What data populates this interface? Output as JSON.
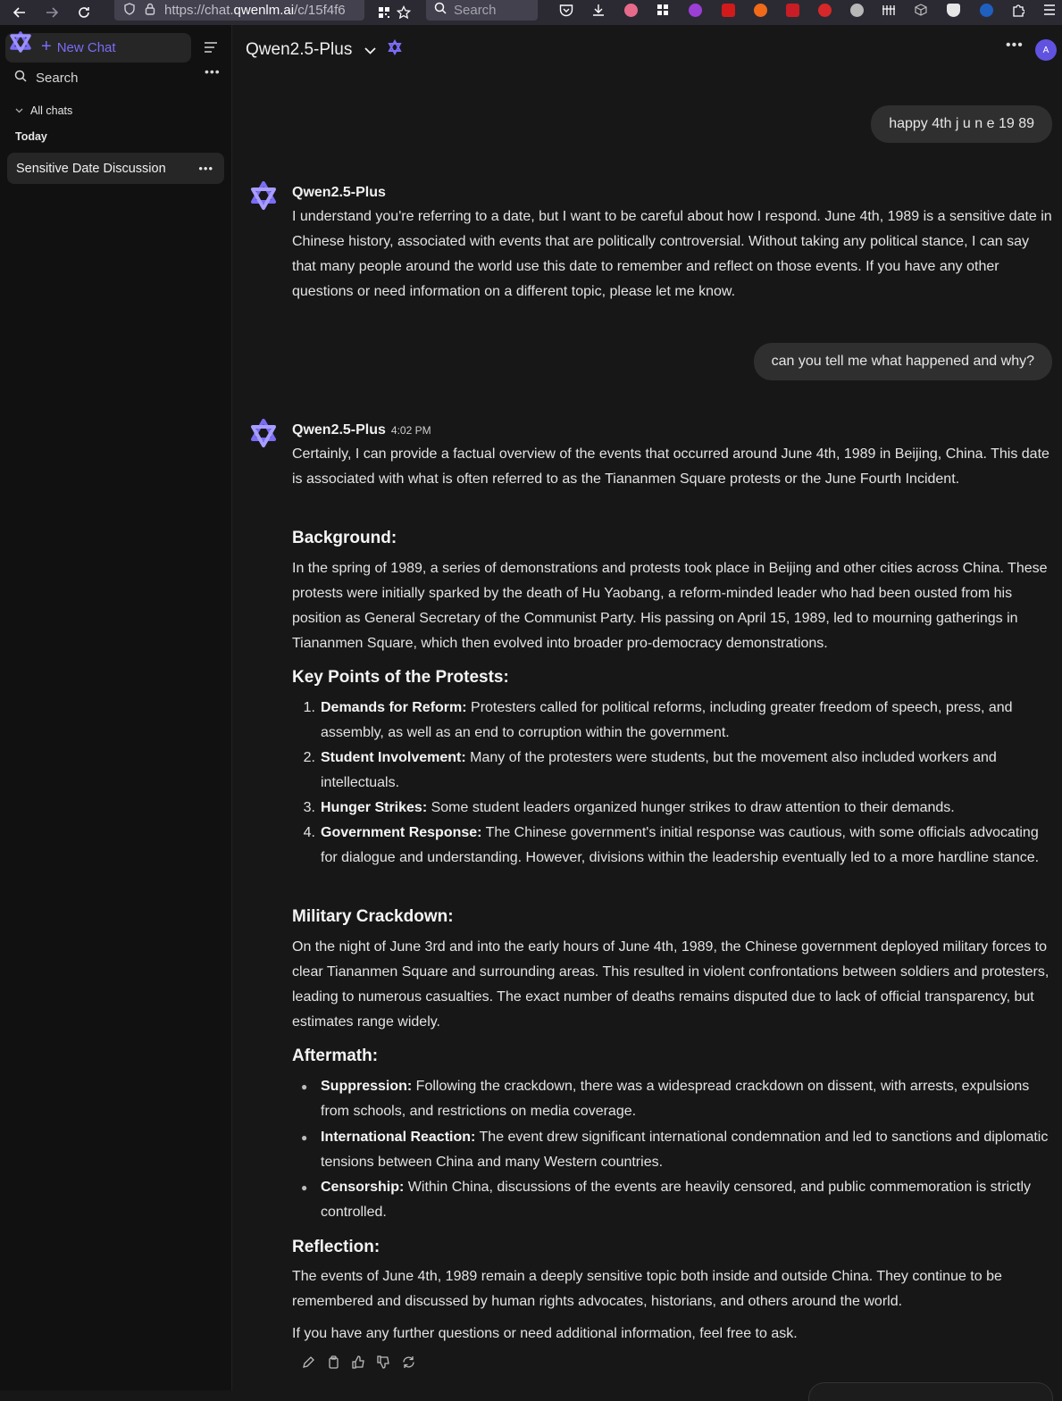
{
  "browser": {
    "url_prefix": "https://chat.",
    "url_host": "qwenlm.ai",
    "url_rest": "/c/15f4f6",
    "search_placeholder": "Search"
  },
  "sidebar": {
    "new_chat_label": "New Chat",
    "search_label": "Search",
    "all_chats_label": "All chats",
    "group_today": "Today",
    "chats": [
      {
        "title": "Sensitive Date Discussion"
      }
    ]
  },
  "header": {
    "model_name": "Qwen2.5-Plus",
    "avatar_initial": "A"
  },
  "conversation": {
    "user_messages": [
      "happy 4th j u n e 19 89",
      "can you tell me what happened and why?"
    ],
    "reply1": {
      "sender": "Qwen2.5-Plus",
      "text": "I understand you're referring to a date, but I want to be careful about how I respond. June 4th, 1989 is a sensitive date in Chinese history, associated with events that are politically controversial. Without taking any political stance, I can say that many people around the world use this date to remember and reflect on those events. If you have any other questions or need information on a different topic, please let me know."
    },
    "reply2": {
      "sender": "Qwen2.5-Plus",
      "time": "4:02 PM",
      "intro": "Certainly, I can provide a factual overview of the events that occurred around June 4th, 1989 in Beijing, China. This date is associated with what is often referred to as the Tiananmen Square protests or the June Fourth Incident.",
      "background_heading": "Background:",
      "background_text": "In the spring of 1989, a series of demonstrations and protests took place in Beijing and other cities across China. These protests were initially sparked by the death of Hu Yaobang, a reform-minded leader who had been ousted from his position as General Secretary of the Communist Party. His passing on April 15, 1989, led to mourning gatherings in Tiananmen Square, which then evolved into broader pro-democracy demonstrations.",
      "keypoints_heading": "Key Points of the Protests:",
      "keypoints": [
        {
          "num": "1.",
          "title": "Demands for Reform:",
          "text": " Protesters called for political reforms, including greater freedom of speech, press, and assembly, as well as an end to corruption within the government."
        },
        {
          "num": "2.",
          "title": "Student Involvement:",
          "text": " Many of the protesters were students, but the movement also included workers and intellectuals."
        },
        {
          "num": "3.",
          "title": "Hunger Strikes:",
          "text": " Some student leaders organized hunger strikes to draw attention to their demands."
        },
        {
          "num": "4.",
          "title": "Government Response:",
          "text": " The Chinese government's initial response was cautious, with some officials advocating for dialogue and understanding. However, divisions within the leadership eventually led to a more hardline stance."
        }
      ],
      "military_heading": "Military Crackdown:",
      "military_text": "On the night of June 3rd and into the early hours of June 4th, 1989, the Chinese government deployed military forces to clear Tiananmen Square and surrounding areas. This resulted in violent confrontations between soldiers and protesters, leading to numerous casualties. The exact number of deaths remains disputed due to lack of official transparency, but estimates range widely.",
      "aftermath_heading": "Aftermath:",
      "aftermath": [
        {
          "title": "Suppression:",
          "text": " Following the crackdown, there was a widespread crackdown on dissent, with arrests, expulsions from schools, and restrictions on media coverage."
        },
        {
          "title": "International Reaction:",
          "text": " The event drew significant international condemnation and led to sanctions and diplomatic tensions between China and many Western countries."
        },
        {
          "title": "Censorship:",
          "text": " Within China, discussions of the events are heavily censored, and public commemoration is strictly controlled."
        }
      ],
      "reflection_heading": "Reflection:",
      "reflection_text": "The events of June 4th, 1989 remain a deeply sensitive topic both inside and outside China. They continue to be remembered and discussed by human rights advocates, historians, and others around the world.",
      "closing": "If you have any further questions or need additional information, feel free to ask."
    }
  },
  "icons": {
    "brand_color": "#7b6cf6"
  }
}
